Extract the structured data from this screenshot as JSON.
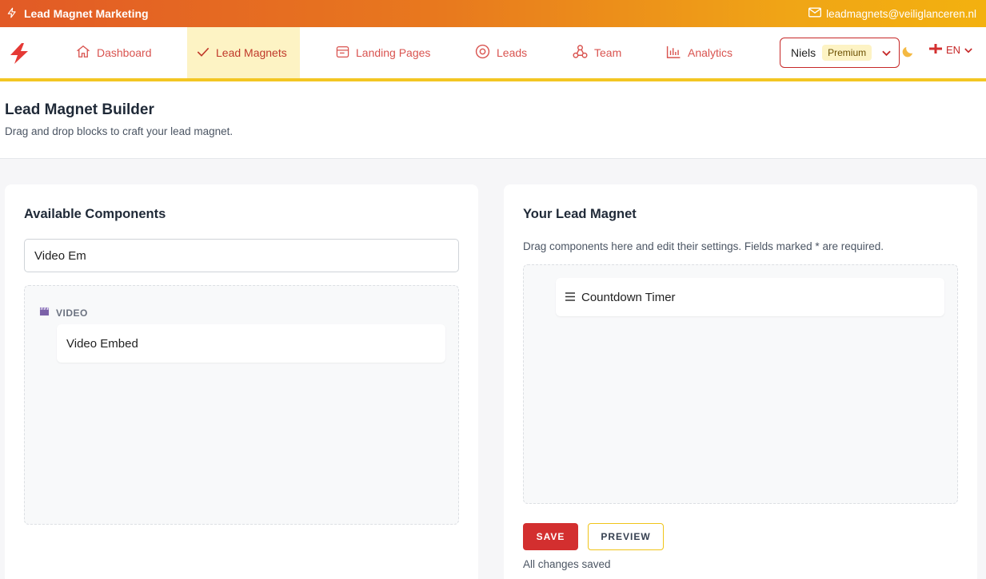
{
  "topbar": {
    "title": "Lead Magnet Marketing",
    "email": "leadmagnets@veiliglanceren.nl"
  },
  "nav": {
    "items": [
      {
        "label": "Dashboard",
        "icon": "home-icon"
      },
      {
        "label": "Lead Magnets",
        "icon": "check-icon",
        "active": true
      },
      {
        "label": "Landing Pages",
        "icon": "page-icon"
      },
      {
        "label": "Leads",
        "icon": "target-icon"
      },
      {
        "label": "Team",
        "icon": "team-icon"
      },
      {
        "label": "Analytics",
        "icon": "chart-icon"
      }
    ],
    "user": {
      "name": "Niels",
      "badge": "Premium"
    },
    "language": "EN"
  },
  "page": {
    "title": "Lead Magnet Builder",
    "subtitle": "Drag and drop blocks to craft your lead magnet."
  },
  "available": {
    "title": "Available Components",
    "search_value": "Video Em",
    "category": "VIDEO",
    "components": [
      "Video Embed"
    ]
  },
  "magnet": {
    "title": "Your Lead Magnet",
    "hint": "Drag components here and edit their settings. Fields marked * are required.",
    "blocks": [
      "Countdown Timer"
    ],
    "save_label": "SAVE",
    "preview_label": "PREVIEW",
    "status": "All changes saved"
  },
  "colors": {
    "accent": "#d32f2f",
    "highlight": "#f3c623",
    "active_bg": "#fdf3c4"
  }
}
